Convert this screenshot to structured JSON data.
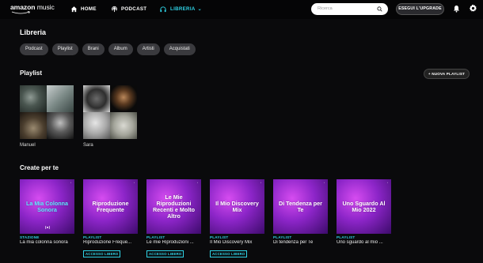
{
  "header": {
    "logo_text": "amazon",
    "logo_music": "music",
    "nav": {
      "home": "HOME",
      "podcast": "PODCAST",
      "library": "LIBRERIA"
    },
    "search_placeholder": "Ricerca",
    "upgrade_label": "ESEGUI L'UPGRADE"
  },
  "colors": {
    "accent": "#2fd3e6",
    "background": "#0a0a0c"
  },
  "library": {
    "title": "Libreria",
    "chips": [
      "Podcast",
      "Playlist",
      "Brani",
      "Album",
      "Artisti",
      "Acquistati"
    ]
  },
  "playlists": {
    "title": "Playlist",
    "new_label": "+ NUOVA PLAYLIST",
    "items": [
      {
        "name": "Manuel"
      },
      {
        "name": "Sara"
      }
    ]
  },
  "created": {
    "title": "Create per te",
    "cards": [
      {
        "art_title": "La Mia Colonna Sonora",
        "type": "STAZIONE",
        "name": "La mia colonna sonora",
        "badge": ""
      },
      {
        "art_title": "Riproduzione Frequente",
        "type": "PLAYLIST",
        "name": "Riproduzione Freque...",
        "badge": "ACCESSO LIBERO"
      },
      {
        "art_title": "Le Mie Riproduzioni Recenti e Molto Altro",
        "type": "PLAYLIST",
        "name": "Le mie Riproduzioni ...",
        "badge": "ACCESSO LIBERO"
      },
      {
        "art_title": "Il Mio Discovery Mix",
        "type": "PLAYLIST",
        "name": "Il Mio Discovery Mix",
        "badge": "ACCESSO LIBERO"
      },
      {
        "art_title": "Di Tendenza per Te",
        "type": "PLAYLIST",
        "name": "Di tendenza per Te",
        "badge": ""
      },
      {
        "art_title": "Uno Sguardo Al Mio 2022",
        "type": "PLAYLIST",
        "name": "Uno sguardo al mio ...",
        "badge": ""
      }
    ]
  }
}
